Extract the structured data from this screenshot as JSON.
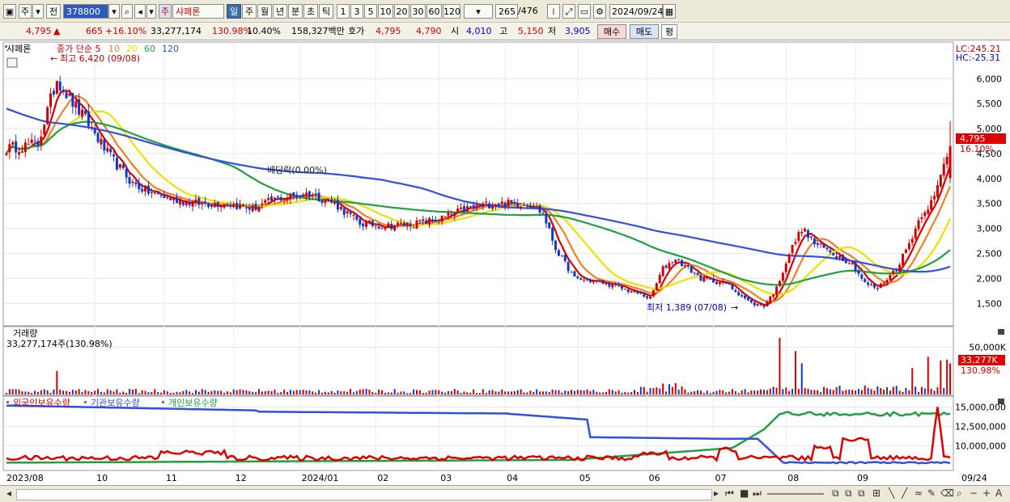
{
  "toolbar": {
    "mode_label": "주",
    "prev_label": "전",
    "code": "378800",
    "name_badge": "주",
    "name": "샤페론",
    "periods": [
      "일",
      "주",
      "월",
      "년",
      "분",
      "초",
      "틱"
    ],
    "active_period": "일",
    "intervals": [
      "1",
      "3",
      "5",
      "10",
      "20",
      "30",
      "60",
      "120"
    ],
    "count": "265",
    "count_total": "/476",
    "date": "2024/09/24"
  },
  "quote": {
    "price": "4,795",
    "change": "665",
    "change_pct": "+16.10%",
    "volume": "33,277,174",
    "volume_ratio": "130.98%",
    "turnover": "10.40%",
    "amount": "158,327백만",
    "bid_label": "호가",
    "ask_price": "4,795",
    "bid_price": "4,790",
    "open_label": "시",
    "open": "4,010",
    "high_label": "고",
    "high": "5,150",
    "low_label": "저",
    "low": "3,905",
    "buy_label": "매수",
    "sell_label": "매도",
    "eval_label": "평"
  },
  "colors": {
    "red": "#dd0000",
    "orange": "#f08020",
    "yellow": "#f0e000",
    "green": "#20a040",
    "blue": "#3050e0",
    "up": "#d00000",
    "down": "#1038c8"
  },
  "chart_data": [
    {
      "type": "candlestick",
      "panel": "price",
      "title": "샤페론",
      "legend": [
        {
          "name": "종가 단순 5",
          "color": "#dd0000"
        },
        {
          "name": "10",
          "color": "#f08020"
        },
        {
          "name": "20",
          "color": "#f0e000"
        },
        {
          "name": "60",
          "color": "#20a040"
        },
        {
          "name": "120",
          "color": "#3050e0"
        }
      ],
      "y_ticks": [
        1500,
        2000,
        2500,
        3000,
        3500,
        4000,
        4500,
        5000,
        5500,
        6000
      ],
      "ylim": [
        1100,
        6700
      ],
      "x_labels": [
        "2023/08",
        "10",
        "11",
        "12",
        "2024/01",
        "02",
        "03",
        "04",
        "05",
        "06",
        "07",
        "08",
        "09",
        "09/24"
      ],
      "price_anchors": [
        [
          0,
          4600
        ],
        [
          10,
          4700
        ],
        [
          16,
          6000
        ],
        [
          20,
          5600
        ],
        [
          26,
          5100
        ],
        [
          32,
          4500
        ],
        [
          40,
          3900
        ],
        [
          46,
          3700
        ],
        [
          52,
          3600
        ],
        [
          60,
          3500
        ],
        [
          70,
          3500
        ],
        [
          78,
          3400
        ],
        [
          86,
          3600
        ],
        [
          96,
          3700
        ],
        [
          104,
          3500
        ],
        [
          112,
          3100
        ],
        [
          120,
          3050
        ],
        [
          130,
          3100
        ],
        [
          138,
          3200
        ],
        [
          146,
          3400
        ],
        [
          154,
          3500
        ],
        [
          160,
          3500
        ],
        [
          166,
          3500
        ],
        [
          170,
          3300
        ],
        [
          174,
          2600
        ],
        [
          180,
          2000
        ],
        [
          190,
          1900
        ],
        [
          200,
          1700
        ],
        [
          204,
          1600
        ],
        [
          208,
          2200
        ],
        [
          212,
          2400
        ],
        [
          220,
          2000
        ],
        [
          228,
          1900
        ],
        [
          236,
          1500
        ],
        [
          240,
          1450
        ],
        [
          244,
          1800
        ],
        [
          248,
          2500
        ],
        [
          252,
          3000
        ],
        [
          256,
          2700
        ],
        [
          262,
          2500
        ],
        [
          268,
          2300
        ],
        [
          272,
          1900
        ],
        [
          276,
          1800
        ],
        [
          282,
          2200
        ],
        [
          286,
          2700
        ],
        [
          290,
          3300
        ],
        [
          294,
          3600
        ],
        [
          298,
          4500
        ],
        [
          300,
          4795
        ]
      ],
      "annotations": {
        "high": "최고 6,420 (09/08)",
        "low": "최저 1,389 (07/08)",
        "dividend": "배당락(0.00%)",
        "lc": "LC:245.21",
        "hc": "HC:-25.31",
        "last_price": "4,795",
        "last_change": "16.10%"
      }
    },
    {
      "type": "bar",
      "panel": "volume",
      "title": "거래량",
      "info": "33,277,174주(130.98%)",
      "y_ticks": [
        50000
      ],
      "y_tick_labels": [
        "50,000K"
      ],
      "ylim": [
        0,
        60000
      ],
      "last_value": "33,277K",
      "last_ratio": "130.98%"
    },
    {
      "type": "line",
      "panel": "holdings",
      "series_names": [
        "외국인보유수량",
        "기관보유수량",
        "개인보유수량"
      ],
      "series_colors": [
        "#dd0000",
        "#3050e0",
        "#20a040"
      ],
      "y_ticks": [
        10000000,
        12500000,
        15000000
      ],
      "y_tick_labels": [
        "10,000,000",
        "12,500,000",
        "15,000,000"
      ],
      "ylim": [
        7000000,
        16000000
      ]
    }
  ]
}
